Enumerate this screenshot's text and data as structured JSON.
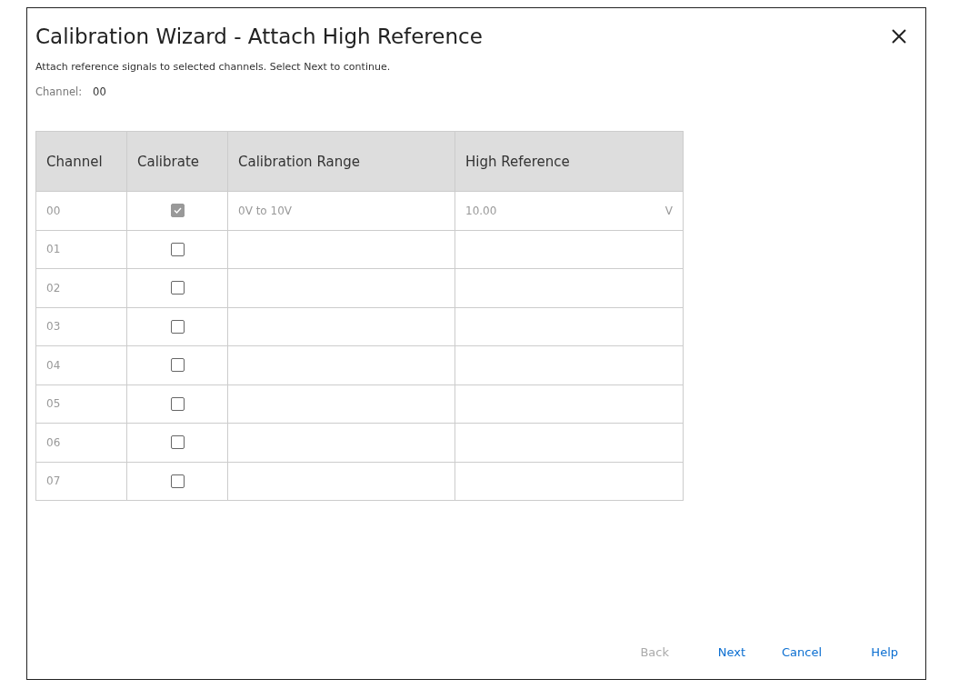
{
  "dialog": {
    "title": "Calibration Wizard -  Attach High Reference",
    "instructions": "Attach reference signals to selected channels. Select Next to continue.",
    "channel_label": "Channel:",
    "channel_value": "00"
  },
  "table": {
    "columns": [
      "Channel",
      "Calibrate",
      "Calibration Range",
      "High Reference"
    ],
    "rows": [
      {
        "channel": "00",
        "checked": true,
        "disabled": true,
        "range": "0V to 10V",
        "reference": "10.00",
        "unit": "V"
      },
      {
        "channel": "01",
        "checked": false,
        "disabled": false
      },
      {
        "channel": "02",
        "checked": false,
        "disabled": false
      },
      {
        "channel": "03",
        "checked": false,
        "disabled": false
      },
      {
        "channel": "04",
        "checked": false,
        "disabled": false
      },
      {
        "channel": "05",
        "checked": false,
        "disabled": false
      },
      {
        "channel": "06",
        "checked": false,
        "disabled": false
      },
      {
        "channel": "07",
        "checked": false,
        "disabled": false
      }
    ]
  },
  "buttons": [
    {
      "label": "Back",
      "disabled": true
    },
    {
      "label": "Next",
      "disabled": false
    },
    {
      "label": "Cancel",
      "disabled": false
    },
    {
      "label": "Help",
      "disabled": false
    }
  ]
}
